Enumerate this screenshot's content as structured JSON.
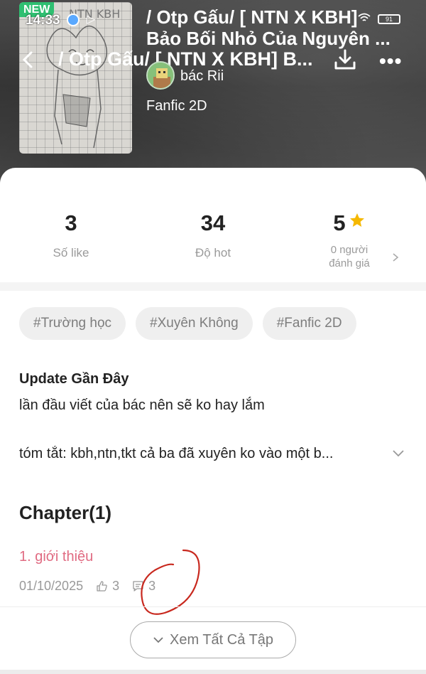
{
  "status_bar": {
    "time": "14:33",
    "battery": "91"
  },
  "header": {
    "badge": "NEW",
    "cover_lettering": "NTN KBH",
    "title_line1": "/ Otp Gấu/ [ NTN X KBH]",
    "title_line2": "Bảo Bối Nhỏ Của Nguyên ...",
    "navbar_title": "/ Otp Gấu/ [ NTN X KBH] B...",
    "author": "bác Rii",
    "genre": "Fanfic 2D"
  },
  "stats": {
    "likes_value": "3",
    "likes_label": "Số like",
    "hot_value": "34",
    "hot_label": "Độ hot",
    "rating_value": "5",
    "rating_label_line1": "0 người",
    "rating_label_line2": "đánh giá"
  },
  "tags": [
    "#Trường học",
    "#Xuyên Không",
    "#Fanfic 2D"
  ],
  "update": {
    "title": "Update Gần Đây",
    "text": "lần đầu viết của bác nên sẽ ko hay lắm"
  },
  "summary": "tóm tắt: kbh,ntn,tkt cả ba đã xuyên ko vào một b...",
  "chapters": {
    "heading": "Chapter(1)",
    "items": [
      {
        "title": "1. giới thiệu",
        "date": "01/10/2025",
        "likes": "3",
        "comments": "3"
      }
    ],
    "see_all_label": "Xem Tất Cả Tập"
  },
  "colors": {
    "chapter_title": "#e06b82",
    "star": "#f5b800",
    "badge_new": "#2fbf71",
    "annotation_circle": "#c8281e"
  }
}
